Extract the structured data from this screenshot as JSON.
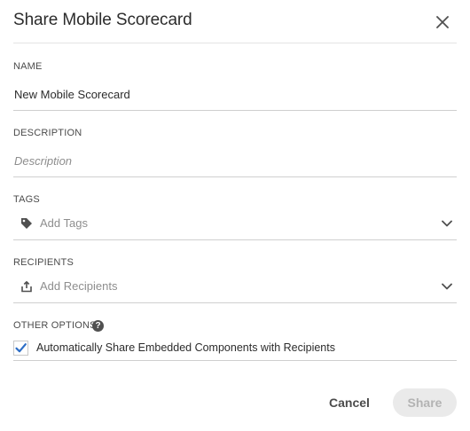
{
  "dialog": {
    "title": "Share Mobile Scorecard",
    "close_icon": "close-icon"
  },
  "fields": {
    "name": {
      "label": "NAME",
      "value": "New Mobile Scorecard"
    },
    "description": {
      "label": "DESCRIPTION",
      "placeholder": "Description"
    },
    "tags": {
      "label": "TAGS",
      "placeholder": "Add Tags",
      "icon": "tag-icon"
    },
    "recipients": {
      "label": "RECIPIENTS",
      "placeholder": "Add Recipients",
      "icon": "share-icon"
    }
  },
  "other_options": {
    "label": "OTHER OPTIONS",
    "help_icon": "help-icon",
    "embed_checkbox": {
      "label": "Automatically Share Embedded Components with Recipients",
      "checked": true
    }
  },
  "footer": {
    "cancel_label": "Cancel",
    "share_label": "Share",
    "share_enabled": false
  },
  "colors": {
    "checkmark": "#2d6ec6",
    "text": "#2c2c2c",
    "disabled_button_bg": "#eaeaea"
  }
}
